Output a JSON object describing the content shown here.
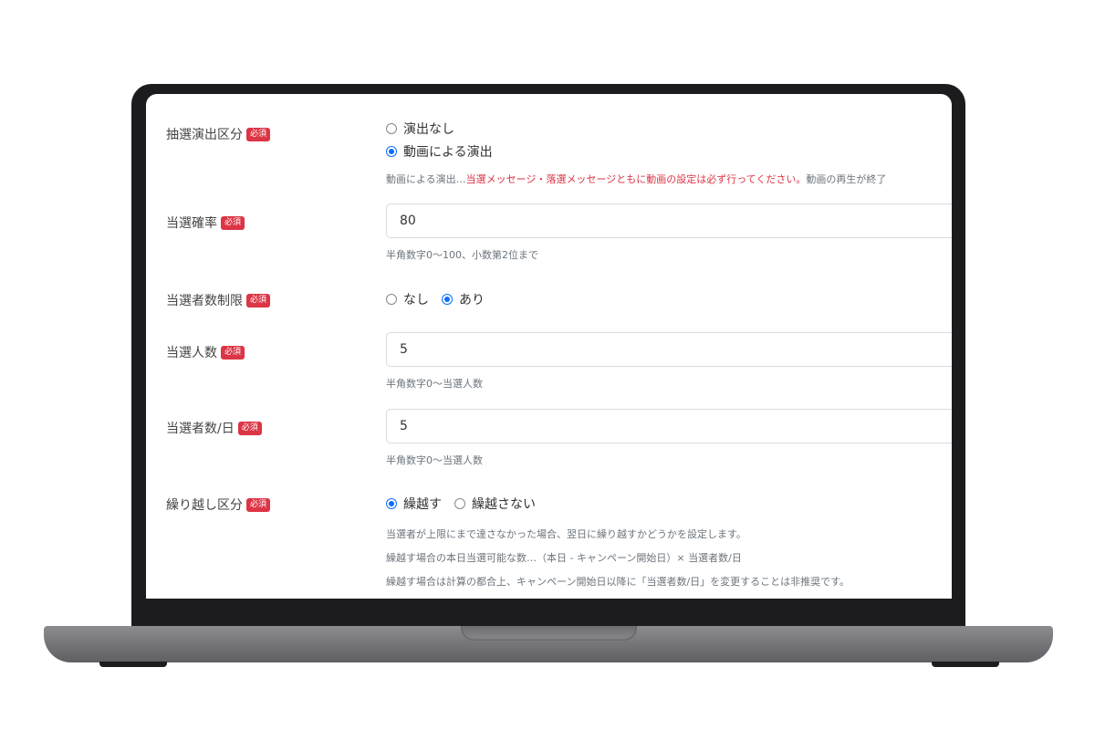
{
  "required_badge": "必須",
  "lottery_effect": {
    "label": "抽選演出区分",
    "options": [
      {
        "label": "演出なし",
        "selected": false
      },
      {
        "label": "動画による演出",
        "selected": true
      }
    ],
    "help_prefix": "動画による演出…",
    "help_warning": "当選メッセージ・落選メッセージともに動画の設定は必ず行ってください。",
    "help_suffix": "動画の再生が終了"
  },
  "win_rate": {
    "label": "当選確率",
    "value": "80",
    "help": "半角数字0〜100、小数第2位まで"
  },
  "winner_limit": {
    "label": "当選者数制限",
    "options": [
      {
        "label": "なし",
        "selected": false
      },
      {
        "label": "あり",
        "selected": true
      }
    ]
  },
  "winner_count": {
    "label": "当選人数",
    "value": "5",
    "help": "半角数字0〜当選人数"
  },
  "winners_per_day": {
    "label": "当選者数/日",
    "value": "5",
    "help": "半角数字0〜当選人数"
  },
  "carryover": {
    "label": "繰り越し区分",
    "options": [
      {
        "label": "繰越す",
        "selected": true
      },
      {
        "label": "繰越さない",
        "selected": false
      }
    ],
    "help_lines": [
      "当選者が上限にまで達さなかった場合、翌日に繰り越すかどうかを設定します。",
      "繰越す場合の本日当選可能な数…（本日 - キャンペーン開始日）× 当選者数/日",
      "繰越す場合は計算の都合上、キャンペーン開始日以降に「当選者数/日」を変更することは非推奨です。"
    ]
  },
  "colors": {
    "accent": "#0d6efd",
    "badge": "#dc3545",
    "warning_text": "#dc3545"
  }
}
